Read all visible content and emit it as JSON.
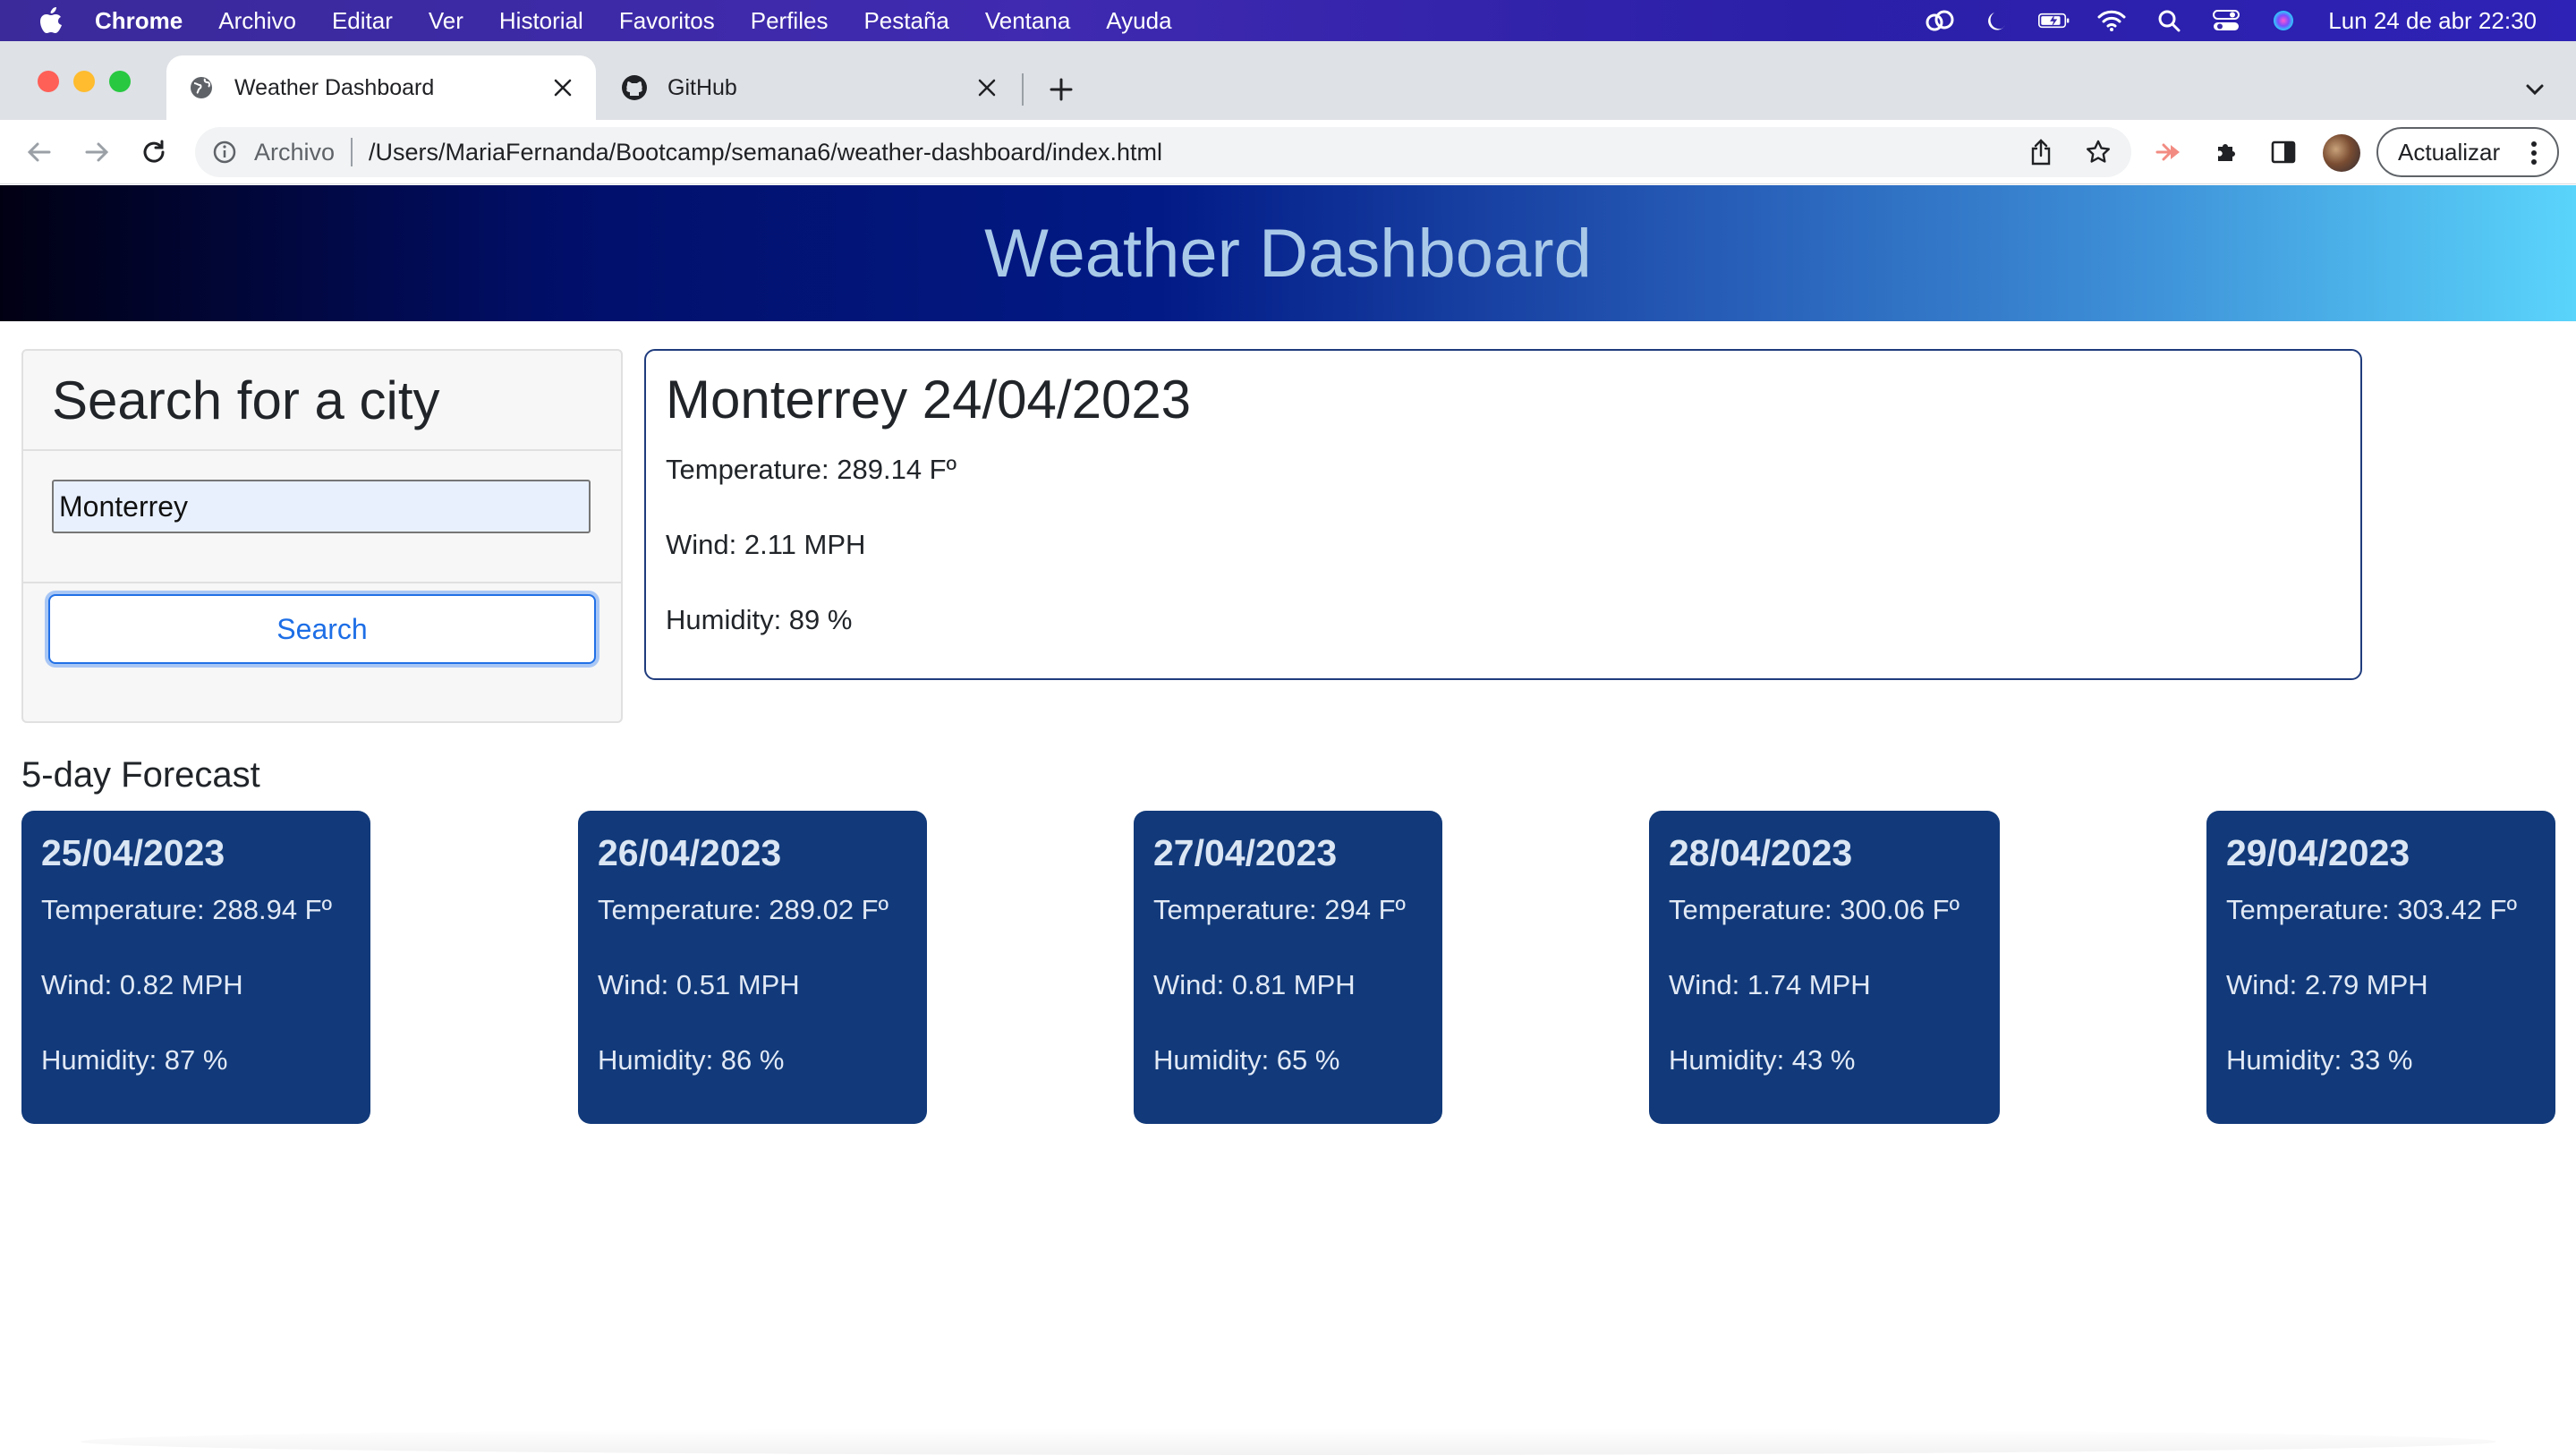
{
  "menubar": {
    "app": "Chrome",
    "items": [
      "Archivo",
      "Editar",
      "Ver",
      "Historial",
      "Favoritos",
      "Perfiles",
      "Pestaña",
      "Ventana",
      "Ayuda"
    ],
    "clock": "Lun 24 de abr  22:30"
  },
  "tabs": [
    {
      "title": "Weather Dashboard",
      "icon": "globe-icon",
      "active": true
    },
    {
      "title": "GitHub",
      "icon": "github-icon",
      "active": false
    }
  ],
  "omnibox": {
    "scheme_label": "Archivo",
    "url": "/Users/MariaFernanda/Bootcamp/semana6/weather-dashboard/index.html"
  },
  "toolbar": {
    "update_label": "Actualizar"
  },
  "header": {
    "title": "Weather Dashboard"
  },
  "search": {
    "heading": "Search for a city",
    "value": "Monterrey",
    "button_label": "Search"
  },
  "current": {
    "city_date": "Monterrey 24/04/2023",
    "temperature": "Temperature: 289.14 Fº",
    "wind": "Wind: 2.11 MPH",
    "humidity": "Humidity: 89 %"
  },
  "forecast": {
    "title": "5-day Forecast",
    "days": [
      {
        "date": "25/04/2023",
        "temperature": "Temperature: 288.94 Fº",
        "wind": "Wind: 0.82 MPH",
        "humidity": "Humidity: 87 %"
      },
      {
        "date": "26/04/2023",
        "temperature": "Temperature: 289.02 Fº",
        "wind": "Wind: 0.51 MPH",
        "humidity": "Humidity: 86 %"
      },
      {
        "date": "27/04/2023",
        "temperature": "Temperature: 294 Fº",
        "wind": "Wind: 0.81 MPH",
        "humidity": "Humidity: 65 %"
      },
      {
        "date": "28/04/2023",
        "temperature": "Temperature: 300.06 Fº",
        "wind": "Wind: 1.74 MPH",
        "humidity": "Humidity: 43 %"
      },
      {
        "date": "29/04/2023",
        "temperature": "Temperature: 303.42 Fº",
        "wind": "Wind: 2.79 MPH",
        "humidity": "Humidity: 33 %"
      }
    ]
  },
  "colors": {
    "forecast_card_bg": "#123a7a",
    "current_card_border": "#1f3c7d",
    "search_button_text": "#1d6ee6",
    "header_title": "#a9c9e8"
  }
}
